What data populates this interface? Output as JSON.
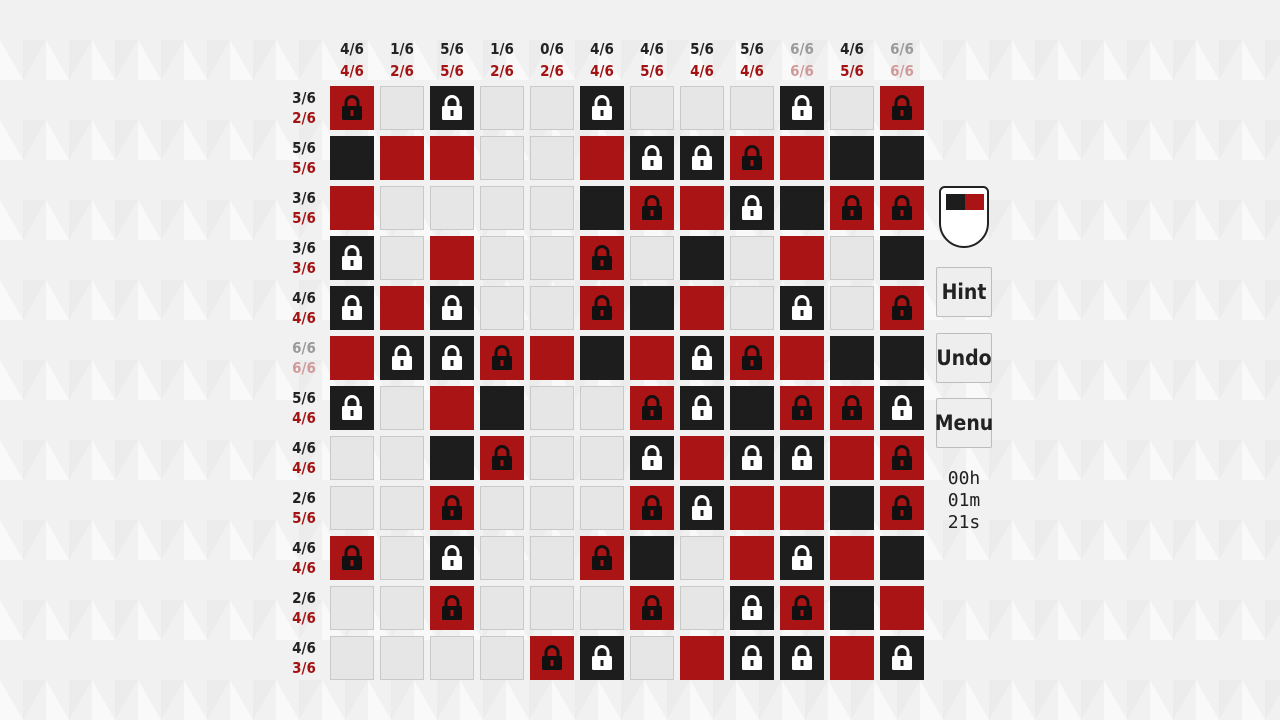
{
  "colors": {
    "black": "#1d1d1d",
    "red": "#ab1414",
    "empty": "#e6e6e6",
    "hint_black": "#222222",
    "hint_red": "#a31313"
  },
  "column_hints": [
    {
      "black": "4/6",
      "red": "4/6",
      "done": false
    },
    {
      "black": "1/6",
      "red": "2/6",
      "done": false
    },
    {
      "black": "5/6",
      "red": "5/6",
      "done": false
    },
    {
      "black": "1/6",
      "red": "2/6",
      "done": false
    },
    {
      "black": "0/6",
      "red": "2/6",
      "done": false
    },
    {
      "black": "4/6",
      "red": "4/6",
      "done": false
    },
    {
      "black": "4/6",
      "red": "5/6",
      "done": false
    },
    {
      "black": "5/6",
      "red": "4/6",
      "done": false
    },
    {
      "black": "5/6",
      "red": "4/6",
      "done": false
    },
    {
      "black": "6/6",
      "red": "6/6",
      "done": true
    },
    {
      "black": "4/6",
      "red": "5/6",
      "done": false
    },
    {
      "black": "6/6",
      "red": "6/6",
      "done": true
    }
  ],
  "row_hints": [
    {
      "black": "3/6",
      "red": "2/6",
      "done": false
    },
    {
      "black": "5/6",
      "red": "5/6",
      "done": false
    },
    {
      "black": "3/6",
      "red": "5/6",
      "done": false
    },
    {
      "black": "3/6",
      "red": "3/6",
      "done": false
    },
    {
      "black": "4/6",
      "red": "4/6",
      "done": false
    },
    {
      "black": "6/6",
      "red": "6/6",
      "done": true
    },
    {
      "black": "5/6",
      "red": "4/6",
      "done": false
    },
    {
      "black": "4/6",
      "red": "4/6",
      "done": false
    },
    {
      "black": "2/6",
      "red": "5/6",
      "done": false
    },
    {
      "black": "4/6",
      "red": "4/6",
      "done": false
    },
    {
      "black": "2/6",
      "red": "4/6",
      "done": false
    },
    {
      "black": "4/6",
      "red": "3/6",
      "done": false
    }
  ],
  "grid": [
    [
      "RL",
      "E",
      "BL",
      "E",
      "E",
      "BL",
      "E",
      "E",
      "E",
      "BL",
      "E",
      "RL"
    ],
    [
      "B",
      "R",
      "R",
      "E",
      "E",
      "R",
      "BL",
      "BL",
      "RL",
      "R",
      "B",
      "B"
    ],
    [
      "R",
      "E",
      "E",
      "E",
      "E",
      "B",
      "RL",
      "R",
      "BL",
      "B",
      "RL",
      "RL"
    ],
    [
      "BL",
      "E",
      "R",
      "E",
      "E",
      "RL",
      "E",
      "B",
      "E",
      "R",
      "E",
      "B"
    ],
    [
      "BL",
      "R",
      "BL",
      "E",
      "E",
      "RL",
      "B",
      "R",
      "E",
      "BL",
      "E",
      "RL"
    ],
    [
      "R",
      "BL",
      "BL",
      "RL",
      "R",
      "B",
      "R",
      "BL",
      "RL",
      "R",
      "B",
      "B"
    ],
    [
      "BL",
      "E",
      "R",
      "B",
      "E",
      "E",
      "RL",
      "BL",
      "B",
      "RL",
      "RL",
      "BL"
    ],
    [
      "E",
      "E",
      "B",
      "RL",
      "E",
      "E",
      "BL",
      "R",
      "BL",
      "BL",
      "R",
      "RL"
    ],
    [
      "E",
      "E",
      "RL",
      "E",
      "E",
      "E",
      "RL",
      "BL",
      "R",
      "R",
      "B",
      "RL"
    ],
    [
      "RL",
      "E",
      "BL",
      "E",
      "E",
      "RL",
      "B",
      "E",
      "R",
      "BL",
      "R",
      "B"
    ],
    [
      "E",
      "E",
      "RL",
      "E",
      "E",
      "E",
      "RL",
      "E",
      "BL",
      "RL",
      "B",
      "R"
    ],
    [
      "E",
      "E",
      "E",
      "E",
      "RL",
      "BL",
      "E",
      "R",
      "BL",
      "BL",
      "R",
      "BL"
    ]
  ],
  "palette": {
    "left_color": "#1d1d1d",
    "right_color": "#ab1414"
  },
  "buttons": {
    "hint": "Hint",
    "undo": "Undo",
    "menu": "Menu"
  },
  "timer": {
    "hours": "00h",
    "minutes": "01m",
    "seconds": "21s"
  }
}
